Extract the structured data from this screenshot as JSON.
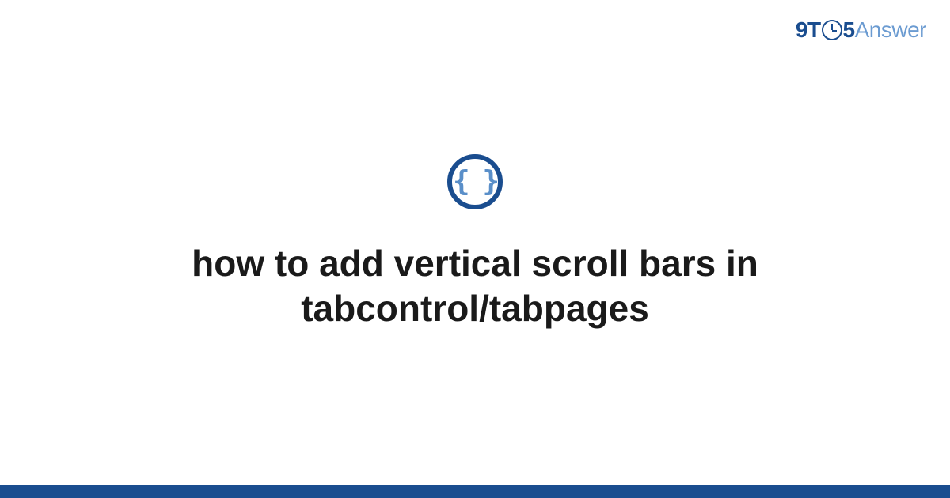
{
  "brand": {
    "part1": "9",
    "part2": "T",
    "part3": "5",
    "part4": "Answer"
  },
  "icon": {
    "glyph": "{ }",
    "name": "code-braces-icon"
  },
  "title": "how to add vertical scroll bars in tabcontrol/tabpages",
  "colors": {
    "brand_dark": "#1a4d8f",
    "brand_light": "#6b9bd1",
    "icon_brace": "#5a8fc9",
    "text": "#1a1a1a",
    "background": "#ffffff"
  }
}
